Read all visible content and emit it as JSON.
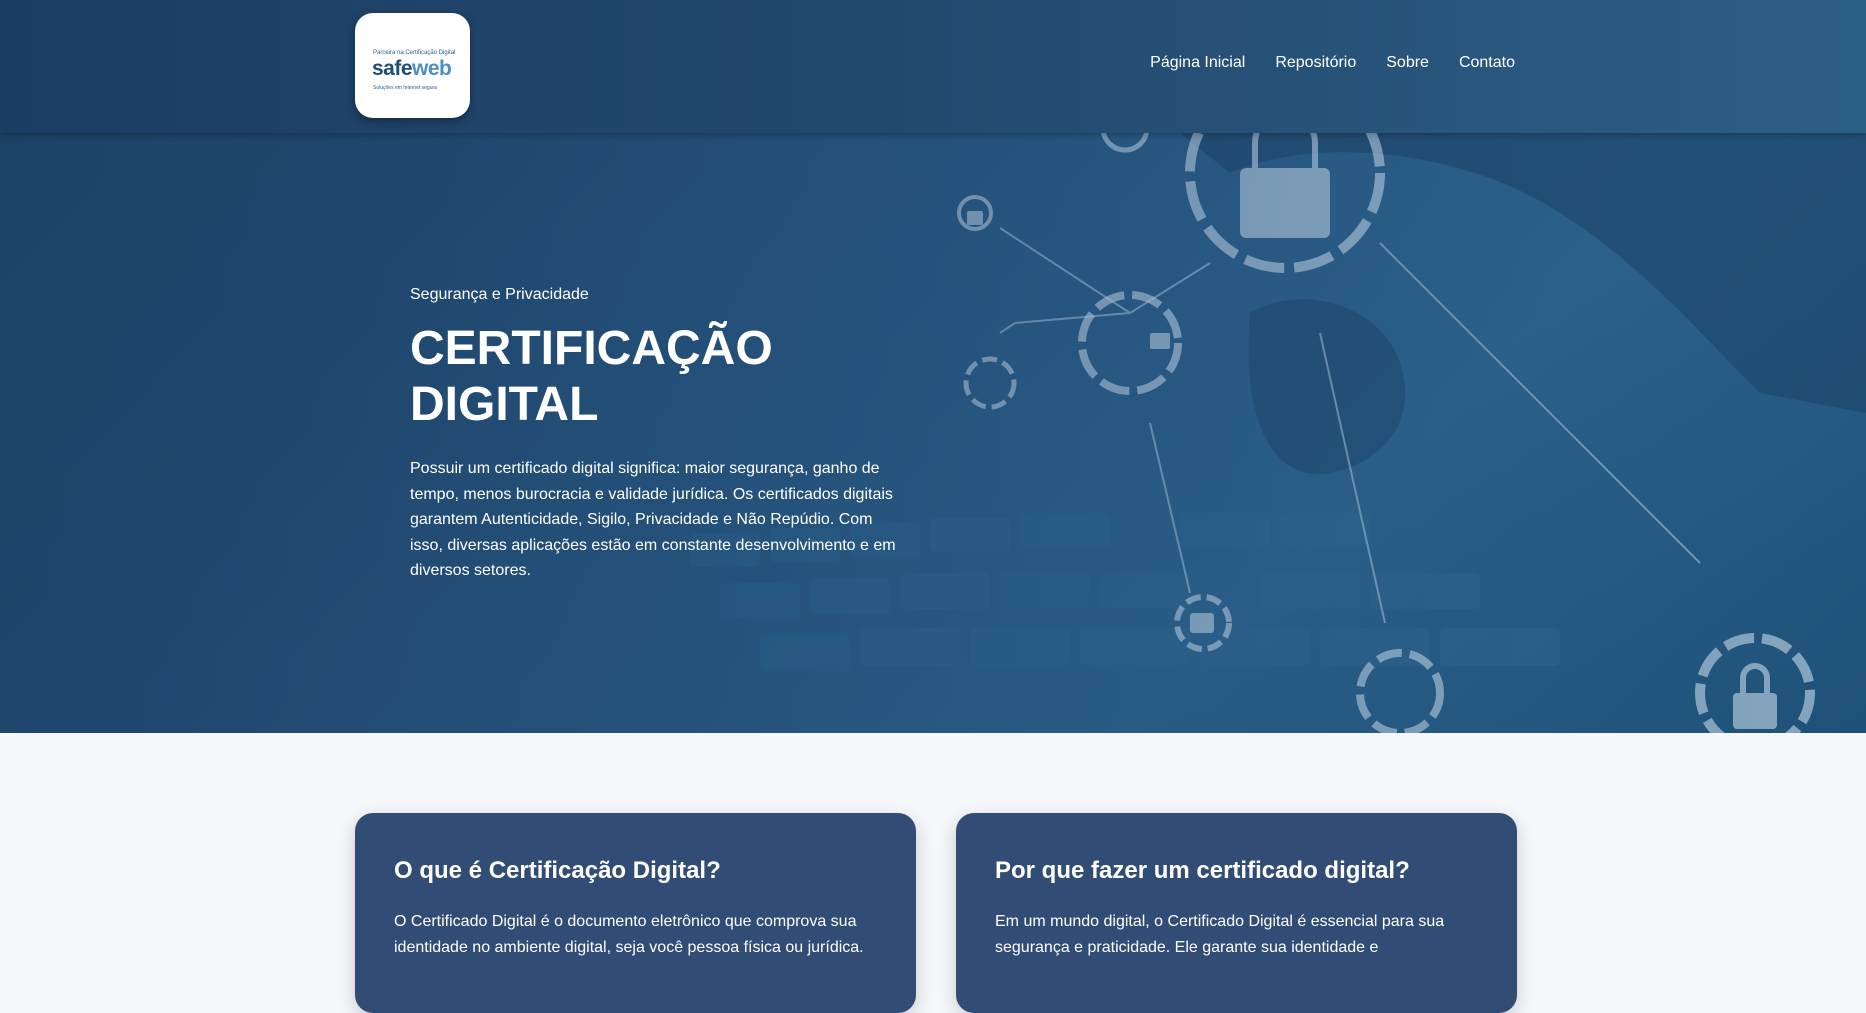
{
  "logo": {
    "tagline": "Parceira na Certificação Digital",
    "wordmark_prefix": "safe",
    "wordmark_suffix": "web",
    "subtitle": "Soluções em Internet segura",
    "brand_color": "#1d4e7a"
  },
  "nav": {
    "items": [
      "Página Inicial",
      "Repositório",
      "Sobre",
      "Contato"
    ]
  },
  "hero": {
    "subtitle": "Segurança e Privacidade",
    "title": "CERTIFICAÇÃO DIGITAL",
    "text": "Possuir um certificado digital significa: maior segurança, ganho de tempo, menos burocracia e validade jurídica. Os certificados digitais garantem Autenticidade, Sigilo, Privacidade e Não Repúdio. Com isso, diversas aplicações estão em constante desenvolvimento e em diversos setores."
  },
  "cards": [
    {
      "title": "O que é Certificação Digital?",
      "text": "O Certificado Digital é o documento eletrônico que comprova sua identidade no ambiente digital, seja você pessoa física ou jurídica."
    },
    {
      "title": "Por que fazer um certificado digital?",
      "text": "Em um mundo digital, o Certificado Digital é essencial para sua segurança e praticidade. Ele garante sua identidade e"
    }
  ],
  "colors": {
    "header": "#23496f",
    "card": "#324d75",
    "page_background": "#f5f7fa"
  }
}
